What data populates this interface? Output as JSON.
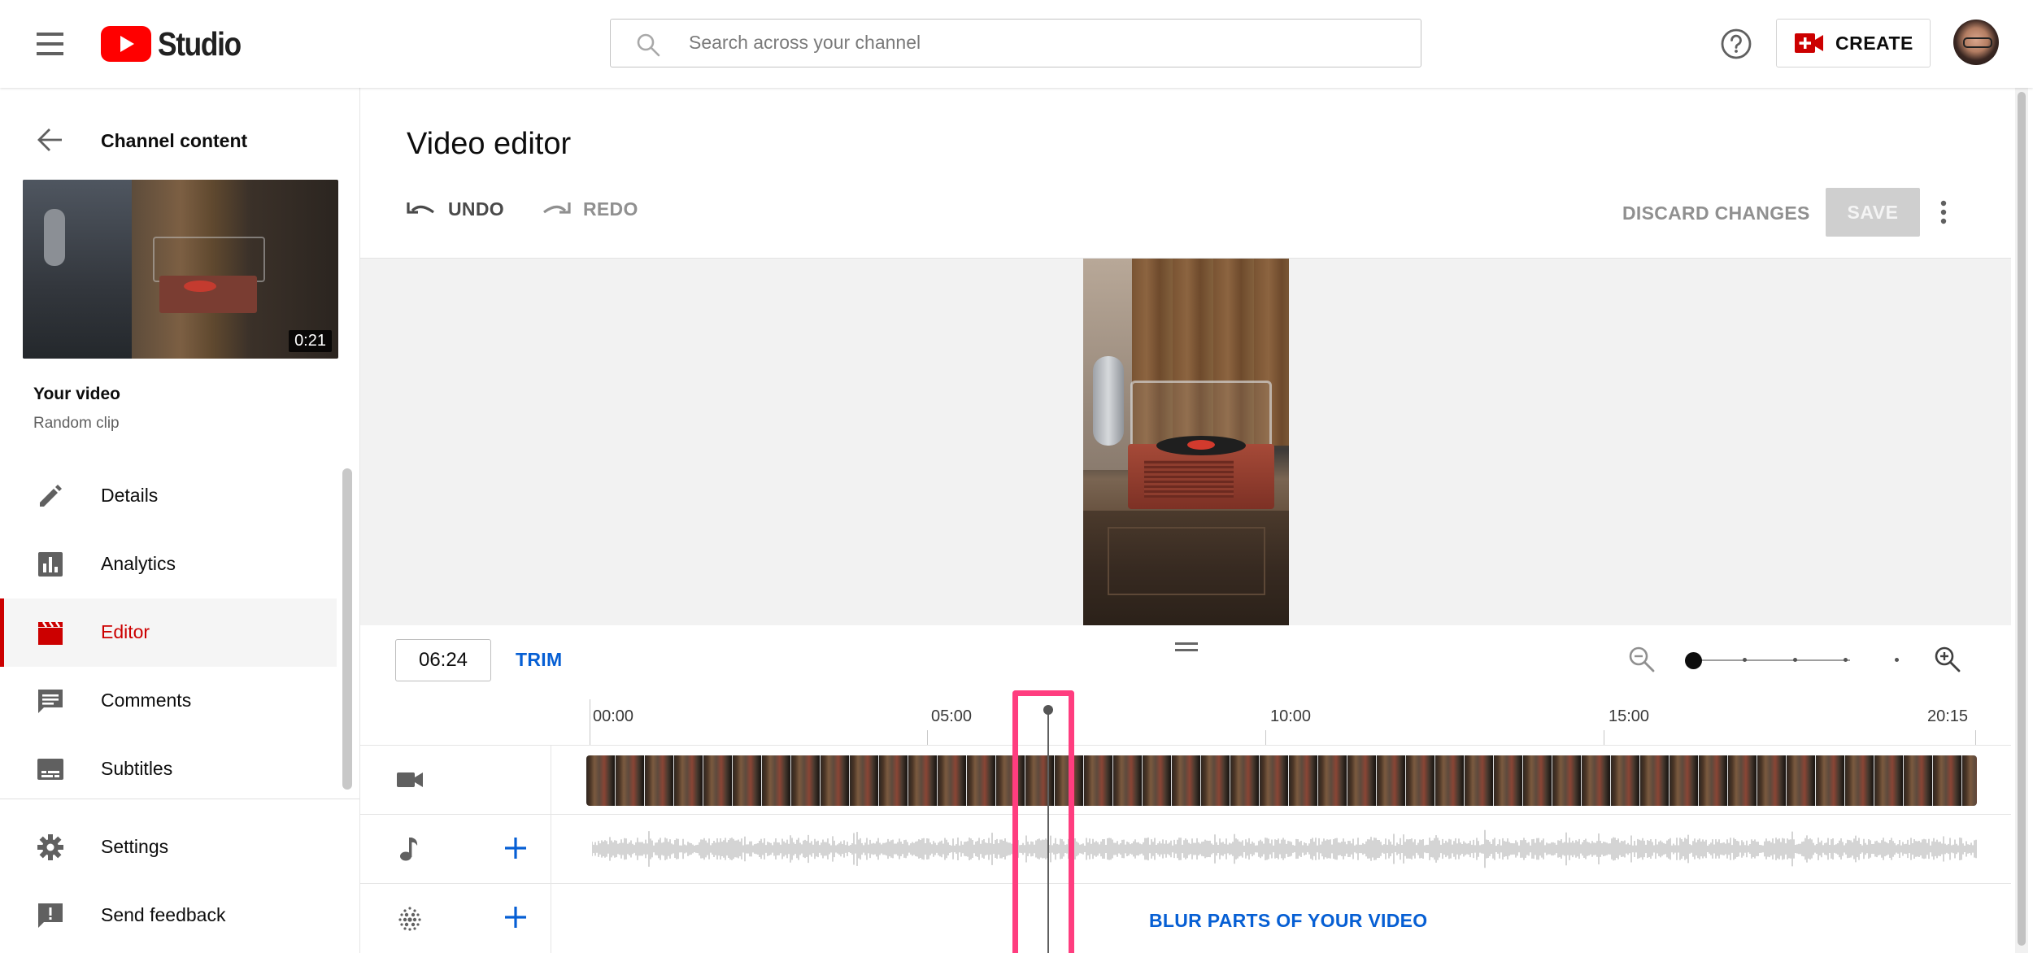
{
  "topbar": {
    "menu_icon": "hamburger-menu-icon",
    "logo_text": "Studio",
    "search_placeholder": "Search across your channel",
    "help_icon": "help-circle-icon",
    "create_label": "CREATE",
    "accent_color": "#ff0000"
  },
  "sidebar": {
    "back_label": "Channel content",
    "video_duration": "0:21",
    "your_video_label": "Your video",
    "video_title": "Random clip",
    "items": [
      {
        "label": "Details",
        "icon": "pencil-icon"
      },
      {
        "label": "Analytics",
        "icon": "bar-chart-icon"
      },
      {
        "label": "Editor",
        "icon": "clapperboard-icon",
        "active": true
      },
      {
        "label": "Comments",
        "icon": "comment-icon"
      },
      {
        "label": "Subtitles",
        "icon": "subtitles-icon"
      }
    ],
    "footer_items": [
      {
        "label": "Settings",
        "icon": "gear-icon"
      },
      {
        "label": "Send feedback",
        "icon": "feedback-icon"
      }
    ],
    "active_color": "#cc0000"
  },
  "editor": {
    "title": "Video editor",
    "undo_label": "UNDO",
    "redo_label": "REDO",
    "discard_label": "DISCARD CHANGES",
    "save_label": "SAVE",
    "current_time": "06:24",
    "trim_label": "TRIM",
    "ruler_labels": [
      "00:00",
      "05:00",
      "10:00",
      "15:00",
      "20:15"
    ],
    "blur_label": "BLUR PARTS OF YOUR VIDEO",
    "link_color": "#065fd4",
    "highlight_color": "#ff3d7f"
  }
}
